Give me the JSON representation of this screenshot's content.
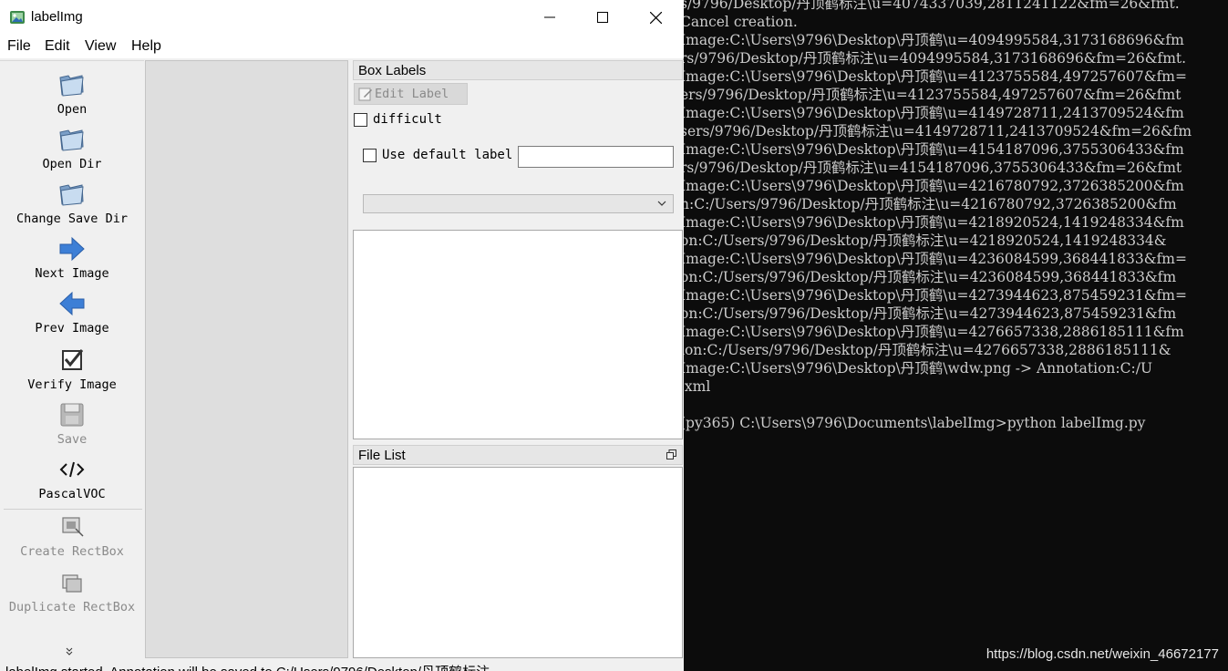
{
  "window": {
    "title": "labelImg",
    "controls": {
      "minimize": "minimize",
      "maximize": "maximize",
      "close": "close"
    }
  },
  "menu": [
    "File",
    "Edit",
    "View",
    "Help"
  ],
  "toolbar": {
    "items": [
      {
        "label": "Open",
        "icon": "folder-open-icon",
        "enabled": true
      },
      {
        "label": "Open Dir",
        "icon": "folder-open-icon",
        "enabled": true
      },
      {
        "label": "Change Save Dir",
        "icon": "folder-open-icon",
        "enabled": true
      },
      {
        "label": "Next Image",
        "icon": "arrow-right-icon",
        "enabled": true
      },
      {
        "label": "Prev Image",
        "icon": "arrow-left-icon",
        "enabled": true
      },
      {
        "label": "Verify Image",
        "icon": "checkbox-icon",
        "enabled": true
      },
      {
        "label": "Save",
        "icon": "floppy-disk-icon",
        "enabled": false
      },
      {
        "label": "PascalVOC",
        "icon": "code-icon",
        "enabled": true
      },
      {
        "label": "Create RectBox",
        "icon": "rectbox-icon",
        "enabled": false
      },
      {
        "label": "Duplicate RectBox",
        "icon": "duplicate-icon",
        "enabled": false
      }
    ],
    "more_indicator": "»"
  },
  "box_labels": {
    "title": "Box Labels",
    "edit_label_button": "Edit Label",
    "difficult_label": "difficult",
    "difficult_checked": false,
    "use_default_label": "Use default label",
    "use_default_checked": false,
    "default_label_value": "",
    "label_dropdown_value": ""
  },
  "file_list": {
    "title": "File List"
  },
  "status": {
    "text": "labelImg started. Annotation will be saved to C:/Users/9796/Desktop/丹顶鹤标注"
  },
  "terminal": {
    "lines": [
      "s/9796/Desktop/丹顶鹤标注\\u=4074337039,2811241122&fm=26&fmt.",
      "Cancel creation.",
      "Image:C:\\Users\\9796\\Desktop\\丹顶鹤\\u=4094995584,3173168696&fm",
      "rs/9796/Desktop/丹顶鹤标注\\u=4094995584,3173168696&fm=26&fmt.",
      "Image:C:\\Users\\9796\\Desktop\\丹顶鹤\\u=4123755584,497257607&fm=",
      "ers/9796/Desktop/丹顶鹤标注\\u=4123755584,497257607&fm=26&fmt",
      "Image:C:\\Users\\9796\\Desktop\\丹顶鹤\\u=4149728711,2413709524&fm",
      "sers/9796/Desktop/丹顶鹤标注\\u=4149728711,2413709524&fm=26&fm",
      "Image:C:\\Users\\9796\\Desktop\\丹顶鹤\\u=4154187096,3755306433&fm",
      "rs/9796/Desktop/丹顶鹤标注\\u=4154187096,3755306433&fm=26&fmt",
      "Image:C:\\Users\\9796\\Desktop\\丹顶鹤\\u=4216780792,3726385200&fm",
      "n:C:/Users/9796/Desktop/丹顶鹤标注\\u=4216780792,3726385200&fm",
      "Image:C:\\Users\\9796\\Desktop\\丹顶鹤\\u=4218920524,1419248334&fm",
      "on:C:/Users/9796/Desktop/丹顶鹤标注\\u=4218920524,1419248334&",
      "Image:C:\\Users\\9796\\Desktop\\丹顶鹤\\u=4236084599,368441833&fm=",
      "on:C:/Users/9796/Desktop/丹顶鹤标注\\u=4236084599,368441833&fm",
      "Image:C:\\Users\\9796\\Desktop\\丹顶鹤\\u=4273944623,875459231&fm=",
      "on:C:/Users/9796/Desktop/丹顶鹤标注\\u=4273944623,875459231&fm",
      "Image:C:\\Users\\9796\\Desktop\\丹顶鹤\\u=4276657338,2886185111&fm",
      "ion:C:/Users/9796/Desktop/丹顶鹤标注\\u=4276657338,2886185111&",
      "Image:C:\\Users\\9796\\Desktop\\丹顶鹤\\wdw.png -> Annotation:C:/U",
      ".xml",
      "",
      "(py365) C:\\Users\\9796\\Documents\\labelImg>python labelImg.py"
    ],
    "watermark": "https://blog.csdn.net/weixin_46672177"
  }
}
